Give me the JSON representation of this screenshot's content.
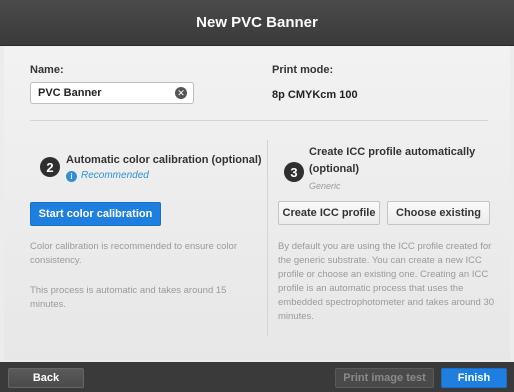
{
  "window": {
    "title": "New PVC Banner"
  },
  "name_section": {
    "label": "Name:",
    "value": "PVC Banner"
  },
  "print_mode": {
    "label": "Print mode:",
    "value": "8p CMYKcm 100"
  },
  "calibration": {
    "step": "2",
    "title": "Automatic color calibration (optional)",
    "recommended": "Recommended",
    "button": "Start color calibration",
    "desc1": "Color calibration is recommended to ensure color consistency.",
    "desc2": "This process is automatic and takes around 15 minutes."
  },
  "icc": {
    "step": "3",
    "title_line1": "Create ICC profile automatically",
    "title_line2": "(optional)",
    "generic": "Generic",
    "create_button": "Create ICC profile",
    "choose_button": "Choose existing",
    "desc": "By default you are using the ICC profile created for the generic substrate. You can create a new ICC profile or choose an existing one. Creating an ICC profile is an automatic process that uses the embedded spectrophotometer and takes around 30 minutes."
  },
  "footer": {
    "back": "Back",
    "print_test": "Print image test",
    "finish": "Finish"
  },
  "icons": {
    "clear": "clear-icon",
    "info": "info-icon"
  },
  "colors": {
    "accent": "#1f7fe0",
    "title_bar": "#3a3a3a",
    "info": "#2f8fd6"
  }
}
